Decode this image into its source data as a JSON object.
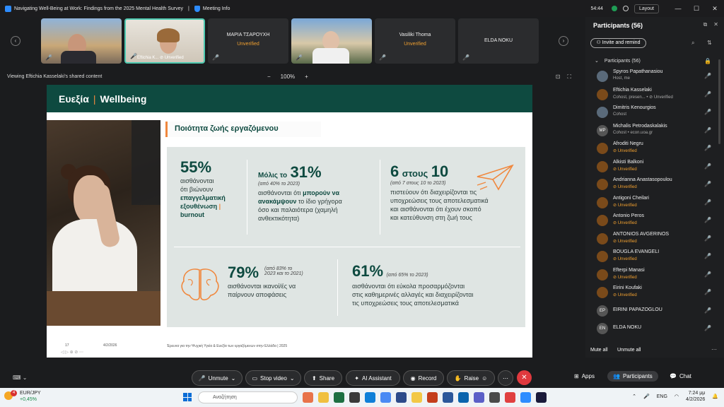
{
  "window": {
    "title": "Navigating Well-Being at Work: Findings from the 2025 Mental Health Survey",
    "meeting_info": "Meeting Info",
    "time": "54:44",
    "layout_label": "Layout"
  },
  "thumbnails": [
    {
      "name": "",
      "status": "",
      "caption": ""
    },
    {
      "name": "",
      "status": "",
      "caption": "Eftichia K... ⊘ Unverified"
    },
    {
      "name": "ΜΑΡΙΑ ΤΣΑΡΟΥΧΗ",
      "status": "Unverified",
      "caption": ""
    },
    {
      "name": "",
      "status": "",
      "caption": ""
    },
    {
      "name": "Vasiliki Thoma",
      "status": "Unverified",
      "caption": ""
    },
    {
      "name": "ELDA NOKU",
      "status": "",
      "caption": ""
    }
  ],
  "viewing": {
    "text": "Viewing Eftichia Kasselaki's shared content",
    "zoom": "100%",
    "minus": "−",
    "plus": "+"
  },
  "slide": {
    "brand": "Ευεξία",
    "brand_sep": "|",
    "brand2": "Wellbeing",
    "subtitle": "Ποιότητα ζωής εργαζόμενου",
    "stat1": {
      "pct": "55%",
      "line1": "αισθάνονται",
      "line2": "ότι βιώνουν",
      "bold1": "επαγγελματική",
      "bold2": "εξουθένωση",
      "bar": "|",
      "bold3": "burnout"
    },
    "stat2": {
      "prefix": "Μόλις το",
      "pct": "31%",
      "note": "(από 40% το 2023)",
      "line1": "αισθάνονται ότι",
      "bold1": "μπορούν να",
      "bold2": "ανακάμψουν",
      "rest1": "το ίδιο γρήγορα",
      "line3": "όσο και παλαιότερα (χαμηλή",
      "line4": "ανθεκτικότητα)"
    },
    "stat3": {
      "a": "6",
      "mid": "στους",
      "b": "10",
      "note": "(από 7 στους 10 το 2023)",
      "line1": "πιστεύουν ότι διαχειρίζονται τις",
      "line2": "υποχρεώσεις τους αποτελεσματικά",
      "line3": "και αισθάνονται ότι έχουν σκοπό",
      "line4": "και κατεύθυνση στη ζωή τους"
    },
    "stat4": {
      "pct": "79%",
      "note1": "(από 83% το",
      "note2": "2023 και το 2021)",
      "line1": "αισθάνονται ικανοί/ές να",
      "line2": "παίρνουν αποφάσεις"
    },
    "stat5": {
      "pct": "61%",
      "note": "(από 65% το 2023)",
      "line1": "αισθάνονται ότι εύκολα προσαρμόζονται",
      "line2": "στις καθημερινές αλλαγές και διαχειρίζονται",
      "line3": "τις υποχρεώσεις τους αποτελεσματικά"
    },
    "footer": {
      "page": "17",
      "date": "4/2/2026",
      "source": "Έρευνα για την Ψυχική Υγεία & Ευεξία των εργαζόμενων στην Ελλάδα | 2025"
    }
  },
  "participants": {
    "title": "Participants (56)",
    "invite": "Invite and remind",
    "group": "Participants (56)",
    "list": [
      {
        "name": "Spyros Papathanasiou",
        "sub": "Host, me",
        "initials": "",
        "unverified": false,
        "mic_on": false
      },
      {
        "name": "Eftichia Kasselaki",
        "sub": "Cohost, presen...  •  ⊘ Unverified",
        "initials": "",
        "unverified": false,
        "mic_on": true
      },
      {
        "name": "Dimitris Kenourgios",
        "sub": "Cohost",
        "initials": "",
        "unverified": false,
        "mic_on": false
      },
      {
        "name": "Michalis Petrodaskalakis",
        "sub": "Cohost • econ.uoa.gr",
        "initials": "MP",
        "unverified": false,
        "mic_on": false
      },
      {
        "name": "Afroditi Negru",
        "sub": "⊘ Unverified",
        "initials": "",
        "unverified": true,
        "mic_on": false
      },
      {
        "name": "Alkisti Balkoni",
        "sub": "⊘ Unverified",
        "initials": "",
        "unverified": true,
        "mic_on": false
      },
      {
        "name": "Andrianna Anastasopoulou",
        "sub": "⊘ Unverified",
        "initials": "",
        "unverified": true,
        "mic_on": false
      },
      {
        "name": "Antigoni Cheilari",
        "sub": "⊘ Unverified",
        "initials": "",
        "unverified": true,
        "mic_on": false
      },
      {
        "name": "Antonio Peros",
        "sub": "⊘ Unverified",
        "initials": "",
        "unverified": true,
        "mic_on": false
      },
      {
        "name": "ANTONIOS AVGERINOS",
        "sub": "⊘ Unverified",
        "initials": "",
        "unverified": true,
        "mic_on": false
      },
      {
        "name": "BOUGLA EVANGELI",
        "sub": "⊘ Unverified",
        "initials": "",
        "unverified": true,
        "mic_on": false
      },
      {
        "name": "Efterpi Manasi",
        "sub": "⊘ Unverified",
        "initials": "",
        "unverified": true,
        "mic_on": false
      },
      {
        "name": "Eirini Koufaki",
        "sub": "⊘ Unverified",
        "initials": "",
        "unverified": true,
        "mic_on": false
      },
      {
        "name": "EIRINI PAPAZOGLOU",
        "sub": "",
        "initials": "EP",
        "unverified": false,
        "mic_on": false
      },
      {
        "name": "ELDA NOKU",
        "sub": "",
        "initials": "EN",
        "unverified": false,
        "mic_on": false
      }
    ],
    "mute_all": "Mute all",
    "unmute_all": "Unmute all"
  },
  "toolbar": {
    "unmute": "Unmute",
    "stop_video": "Stop video",
    "share": "Share",
    "ai_assistant": "AI Assistant",
    "record": "Record",
    "raise": "Raise",
    "apps": "Apps",
    "participants": "Participants",
    "chat": "Chat"
  },
  "taskbar": {
    "ticker": "EUR/JPY",
    "ticker_change": "+0,45%",
    "badge": "4",
    "search_placeholder": "Αναζήτηση",
    "lang": "ENG",
    "time": "7:24 μμ",
    "date": "4/2/2026"
  },
  "colors": {
    "brand": "#0e4a40",
    "accent": "#f0883e",
    "end": "#e0393e",
    "unverified": "#f0a030"
  }
}
